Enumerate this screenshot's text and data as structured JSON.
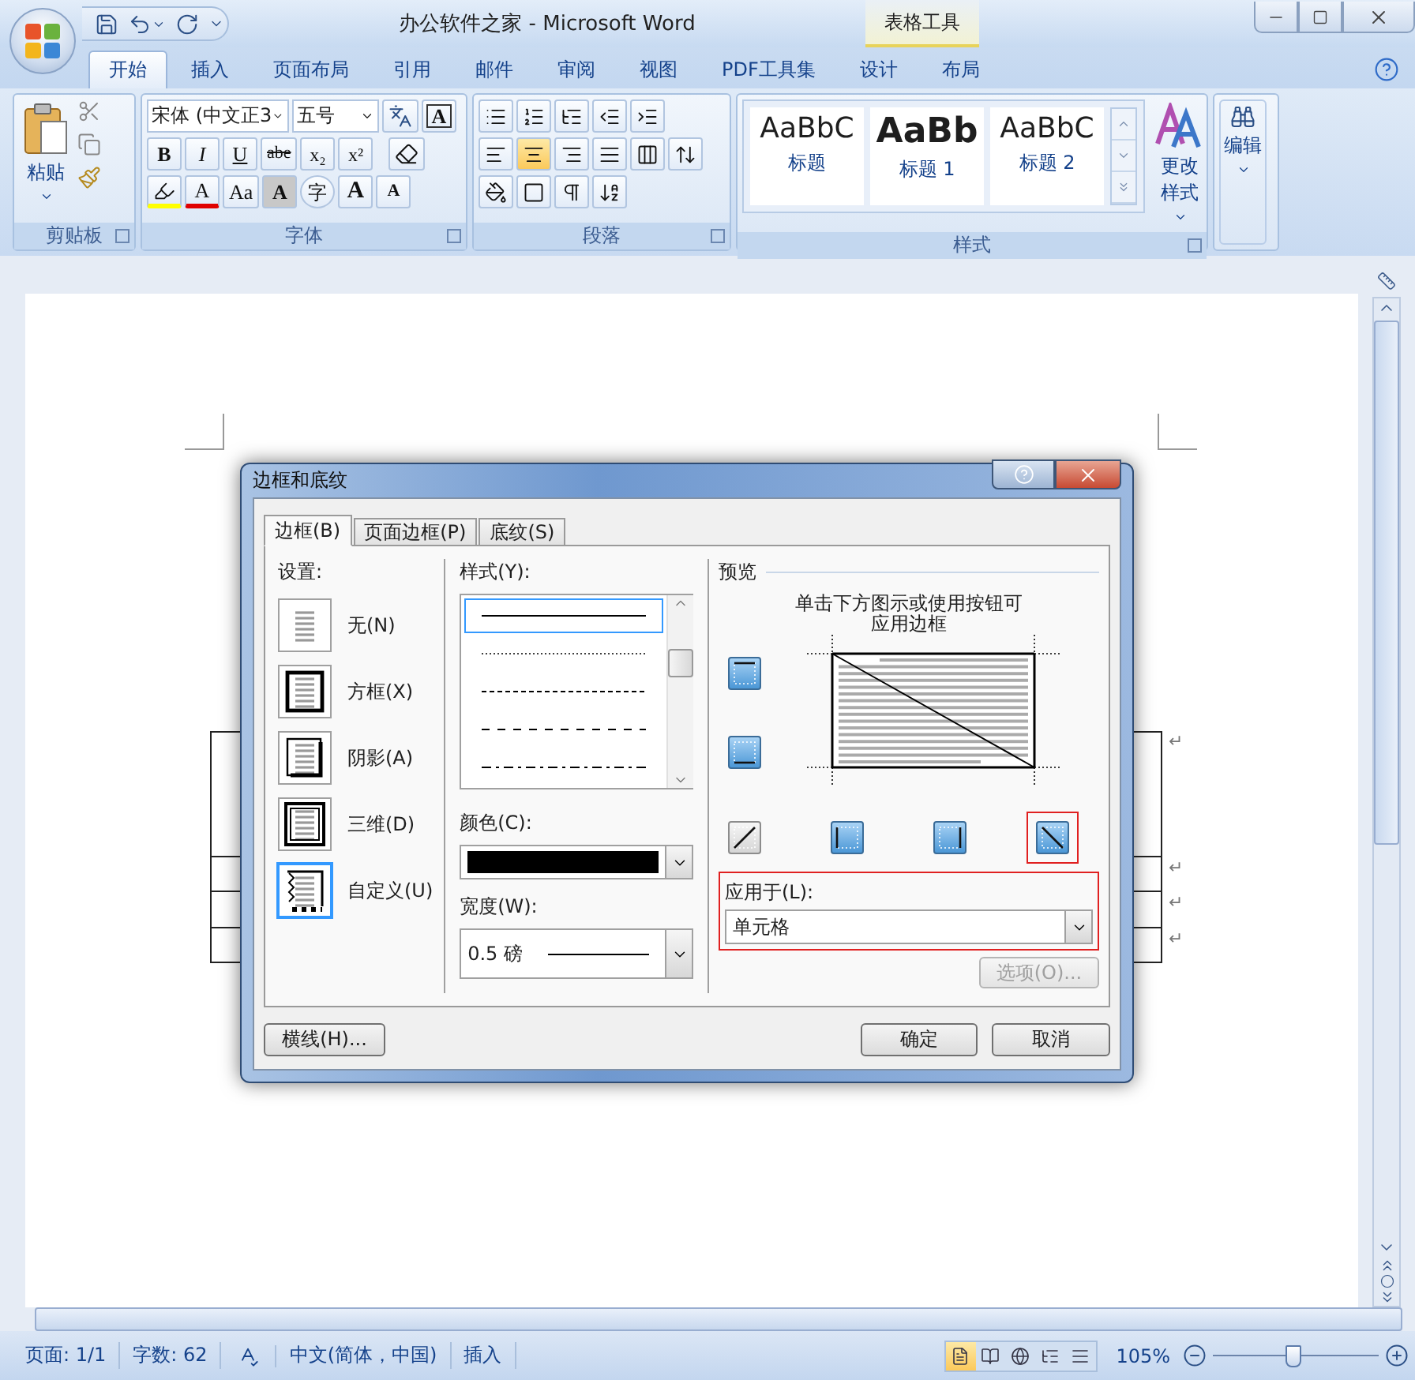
{
  "window": {
    "title": "办公软件之家 - Microsoft Word",
    "context_group": "表格工具"
  },
  "tabs": [
    {
      "label": "开始",
      "selected": true
    },
    {
      "label": "插入",
      "selected": false
    },
    {
      "label": "页面布局",
      "selected": false
    },
    {
      "label": "引用",
      "selected": false
    },
    {
      "label": "邮件",
      "selected": false
    },
    {
      "label": "审阅",
      "selected": false
    },
    {
      "label": "视图",
      "selected": false
    },
    {
      "label": "PDF工具集",
      "selected": false
    },
    {
      "label": "设计",
      "selected": false
    },
    {
      "label": "布局",
      "selected": false
    }
  ],
  "ribbon": {
    "clipboard": {
      "label": "剪贴板",
      "paste": "粘贴"
    },
    "font": {
      "label": "字体",
      "font_name": "宋体 (中文正3",
      "font_size": "五号",
      "border_button": "A",
      "row2": [
        {
          "kind": "bold",
          "label": "B"
        },
        {
          "kind": "italic",
          "label": "I"
        },
        {
          "kind": "underline",
          "label": "U"
        },
        {
          "kind": "strike",
          "label": "abe"
        },
        {
          "kind": "sub",
          "label": "x₂"
        },
        {
          "kind": "sup",
          "label": "x²"
        }
      ],
      "row3": [
        {
          "kind": "font_color",
          "label": "A"
        },
        {
          "kind": "case",
          "label": "Aa"
        },
        {
          "kind": "shading",
          "label": "A"
        },
        {
          "kind": "enclose",
          "label": "字"
        },
        {
          "kind": "grow",
          "label": "A"
        },
        {
          "kind": "shrink",
          "label": "A"
        }
      ]
    },
    "paragraph": {
      "label": "段落",
      "alignments": [
        {
          "kind": "left",
          "selected": false
        },
        {
          "kind": "center",
          "selected": true
        },
        {
          "kind": "right",
          "selected": false
        },
        {
          "kind": "justify",
          "selected": false
        },
        {
          "kind": "distributed",
          "selected": false
        }
      ]
    },
    "styles": {
      "label": "样式",
      "items": [
        {
          "sample": "AaBbC",
          "name": "标题",
          "bold": false
        },
        {
          "sample": "AaBb",
          "name": "标题 1",
          "bold": true
        },
        {
          "sample": "AaBbC",
          "name": "标题 2",
          "bold": false
        }
      ],
      "change": "更改样式"
    },
    "editing": {
      "label": "编辑"
    }
  },
  "document": {
    "table_row_marks": [
      "↵",
      "↵",
      "↵",
      "↵"
    ]
  },
  "dialog": {
    "title": "边框和底纹",
    "tabs": [
      {
        "label": "边框(B)",
        "selected": true
      },
      {
        "label": "页面边框(P)",
        "selected": false
      },
      {
        "label": "底纹(S)",
        "selected": false
      }
    ],
    "settings_label": "设置:",
    "settings": [
      {
        "kind": "none",
        "label": "无(N)",
        "selected": false
      },
      {
        "kind": "box",
        "label": "方框(X)",
        "selected": false
      },
      {
        "kind": "shadow",
        "label": "阴影(A)",
        "selected": false
      },
      {
        "kind": "raised",
        "label": "三维(D)",
        "selected": false
      },
      {
        "kind": "custom",
        "label": "自定义(U)",
        "selected": true
      }
    ],
    "style_label": "样式(Y):",
    "line_styles": [
      {
        "kind": "solid",
        "selected": true
      },
      {
        "kind": "dotted",
        "selected": false
      },
      {
        "kind": "dashed",
        "selected": false
      },
      {
        "kind": "long-dash",
        "selected": false
      },
      {
        "kind": "dash-dot",
        "selected": false
      }
    ],
    "color_label": "颜色(C):",
    "color": "#000000",
    "width_label": "宽度(W):",
    "width": "0.5 磅",
    "preview_label": "预览",
    "preview_hint": "单击下方图示或使用按钮可应用边框",
    "border_buttons": [
      {
        "kind": "top",
        "on": true,
        "highlighted": false
      },
      {
        "kind": "bottom",
        "on": true,
        "highlighted": false
      },
      {
        "kind": "diagonal-up",
        "on": false,
        "highlighted": false
      },
      {
        "kind": "left",
        "on": true,
        "highlighted": false
      },
      {
        "kind": "right",
        "on": true,
        "highlighted": false
      },
      {
        "kind": "diagonal-down",
        "on": true,
        "highlighted": true
      }
    ],
    "apply_to": {
      "label": "应用于(L):",
      "value": "单元格",
      "highlighted": true
    },
    "options_button": {
      "label": "选项(O)...",
      "disabled": true
    },
    "horizontal_line_button": "横线(H)...",
    "ok": "确定",
    "cancel": "取消"
  },
  "status_bar": {
    "page": "页面: 1/1",
    "words": "字数: 62",
    "language": "中文(简体，中国)",
    "mode": "插入",
    "views": [
      {
        "kind": "print",
        "selected": true
      },
      {
        "kind": "reading",
        "selected": false
      },
      {
        "kind": "web",
        "selected": false
      },
      {
        "kind": "outline",
        "selected": false
      },
      {
        "kind": "draft",
        "selected": false
      }
    ],
    "zoom": "105%",
    "zoom_slider": {
      "level": 0.48
    }
  }
}
